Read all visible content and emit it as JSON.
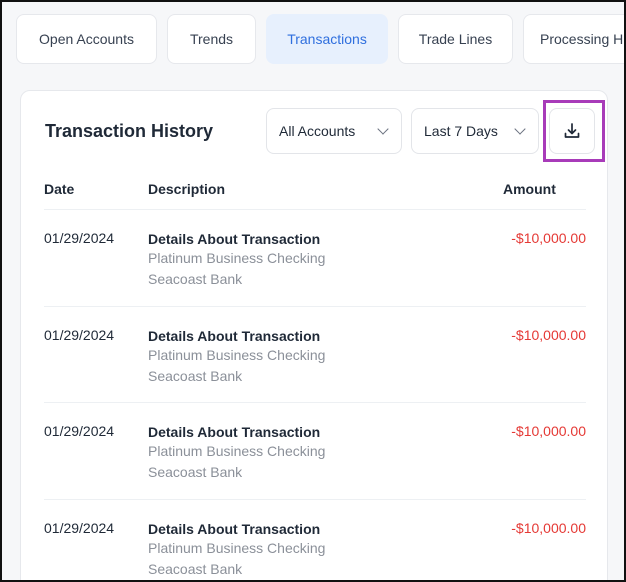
{
  "tabs": [
    {
      "label": "Open Accounts",
      "active": false
    },
    {
      "label": "Trends",
      "active": false
    },
    {
      "label": "Transactions",
      "active": true
    },
    {
      "label": "Trade Lines",
      "active": false
    },
    {
      "label": "Processing His",
      "active": false
    }
  ],
  "card": {
    "title": "Transaction History",
    "accounts_filter": "All Accounts",
    "range_filter": "Last 7 Days",
    "download_icon": "download-icon"
  },
  "table": {
    "headers": {
      "date": "Date",
      "description": "Description",
      "amount": "Amount"
    },
    "rows": [
      {
        "date": "01/29/2024",
        "title": "Details About Transaction",
        "account": "Platinum Business Checking",
        "bank": "Seacoast Bank",
        "amount": "-$10,000.00"
      },
      {
        "date": "01/29/2024",
        "title": "Details About Transaction",
        "account": "Platinum Business Checking",
        "bank": "Seacoast Bank",
        "amount": "-$10,000.00"
      },
      {
        "date": "01/29/2024",
        "title": "Details About Transaction",
        "account": "Platinum Business Checking",
        "bank": "Seacoast Bank",
        "amount": "-$10,000.00"
      },
      {
        "date": "01/29/2024",
        "title": "Details About Transaction",
        "account": "Platinum Business Checking",
        "bank": "Seacoast Bank",
        "amount": "-$10,000.00"
      }
    ]
  },
  "colors": {
    "accent": "#2f6fde",
    "active_tab_bg": "#e7f0fd",
    "negative_amount": "#e53935",
    "highlight_outline": "#a83bb9"
  }
}
